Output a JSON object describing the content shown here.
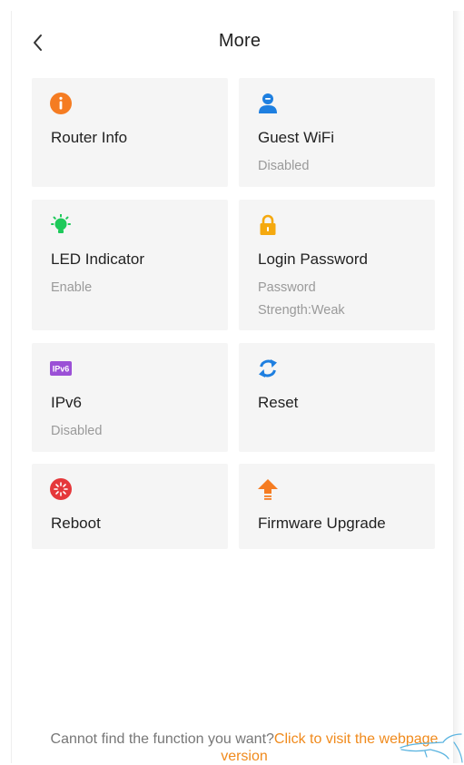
{
  "header": {
    "title": "More",
    "back_icon": "chevron-left-icon"
  },
  "cards": [
    {
      "label": "Router Info",
      "sub": "",
      "icon": "info-icon",
      "color": "#f57c22"
    },
    {
      "label": "Guest WiFi",
      "sub": "Disabled",
      "icon": "guest-user-icon",
      "color": "#1e7fe0"
    },
    {
      "label": "LED Indicator",
      "sub": "Enable",
      "icon": "bulb-icon",
      "color": "#1ec95a"
    },
    {
      "label": "Login Password",
      "sub": "Password Strength:Weak",
      "sub_line1": "Password",
      "sub_line2": "Strength:Weak",
      "icon": "lock-icon",
      "color": "#f5a90f"
    },
    {
      "label": "IPv6",
      "sub": "Disabled",
      "icon": "ipv6-badge-icon",
      "icon_text": "IPv6",
      "color": "#9b50d6"
    },
    {
      "label": "Reset",
      "sub": "",
      "icon": "refresh-arrows-icon",
      "color": "#1e7fe0"
    },
    {
      "label": "Reboot",
      "sub": "",
      "icon": "reboot-icon",
      "color": "#e5383b"
    },
    {
      "label": "Firmware Upgrade",
      "sub": "",
      "icon": "upgrade-arrow-icon",
      "color": "#f57c22"
    }
  ],
  "footer": {
    "prefix": "Cannot find the function you want?",
    "link": "Click to visit the webpage version",
    "link_color": "#f08a1c"
  }
}
